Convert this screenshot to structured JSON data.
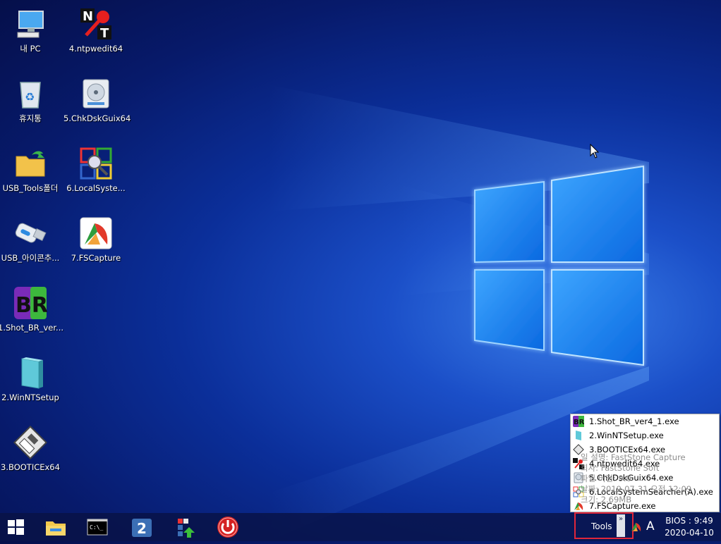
{
  "desktop": {
    "icons": [
      {
        "label": "내 PC",
        "icon": "pc-icon"
      },
      {
        "label": "4.ntpwedit64",
        "icon": "ntpwedit-icon"
      },
      {
        "label": "휴지통",
        "icon": "recycle-bin-icon"
      },
      {
        "label": "5.ChkDskGuix64",
        "icon": "disk-icon"
      },
      {
        "label": "USB_Tools폴더",
        "icon": "folder-icon"
      },
      {
        "label": "6.LocalSyste...",
        "icon": "local-system-searcher-icon"
      },
      {
        "label": "USB_아이콘추...",
        "icon": "usb-drive-icon"
      },
      {
        "label": "7.FSCapture",
        "icon": "fscapture-icon"
      },
      {
        "label": "1.Shot_BR_ver...",
        "icon": "shot-br-icon"
      },
      {
        "label": "2.WinNTSetup",
        "icon": "winntsetup-icon"
      },
      {
        "label": "3.BOOTICEx64",
        "icon": "bootice-icon"
      }
    ]
  },
  "popup_menu": {
    "items": [
      {
        "label": "1.Shot_BR_ver4_1.exe",
        "icon": "shot-br-icon"
      },
      {
        "label": "2.WinNTSetup.exe",
        "icon": "winntsetup-icon"
      },
      {
        "label": "3.BOOTICEx64.exe",
        "icon": "bootice-icon"
      },
      {
        "label": "4.ntpwedit64.exe",
        "icon": "ntpwedit-icon"
      },
      {
        "label": "5.ChkDskGuix64.exe",
        "icon": "disk-icon"
      },
      {
        "label": "6.LocalSystemSearcher(A).exe",
        "icon": "local-system-searcher-icon"
      },
      {
        "label": "7.FSCapture.exe",
        "icon": "fscapture-icon"
      }
    ]
  },
  "tooltip": {
    "line1": "일 설명: FastStone Capture",
    "line2": "회사: FastStone Soft",
    "line3": "파일 버전: 9.0",
    "line4": "날짜: 2019-07-31 오전 12:09",
    "line5": "크기: 2.69MB"
  },
  "taskbar": {
    "start_icon": "windows-start-icon",
    "pinned": [
      "file-explorer-icon",
      "command-prompt-icon",
      "app-2-icon",
      "app-upload-icon",
      "power-icon"
    ],
    "tools_label": "Tools",
    "tools_chevron": "»",
    "ime_indicator": "A",
    "clock_line1": "BIOS : 9:49",
    "clock_line2": "2020-04-10"
  },
  "colors": {
    "highlight_box": "#e0263a",
    "wallpaper_blue": "#1b4fc8"
  }
}
